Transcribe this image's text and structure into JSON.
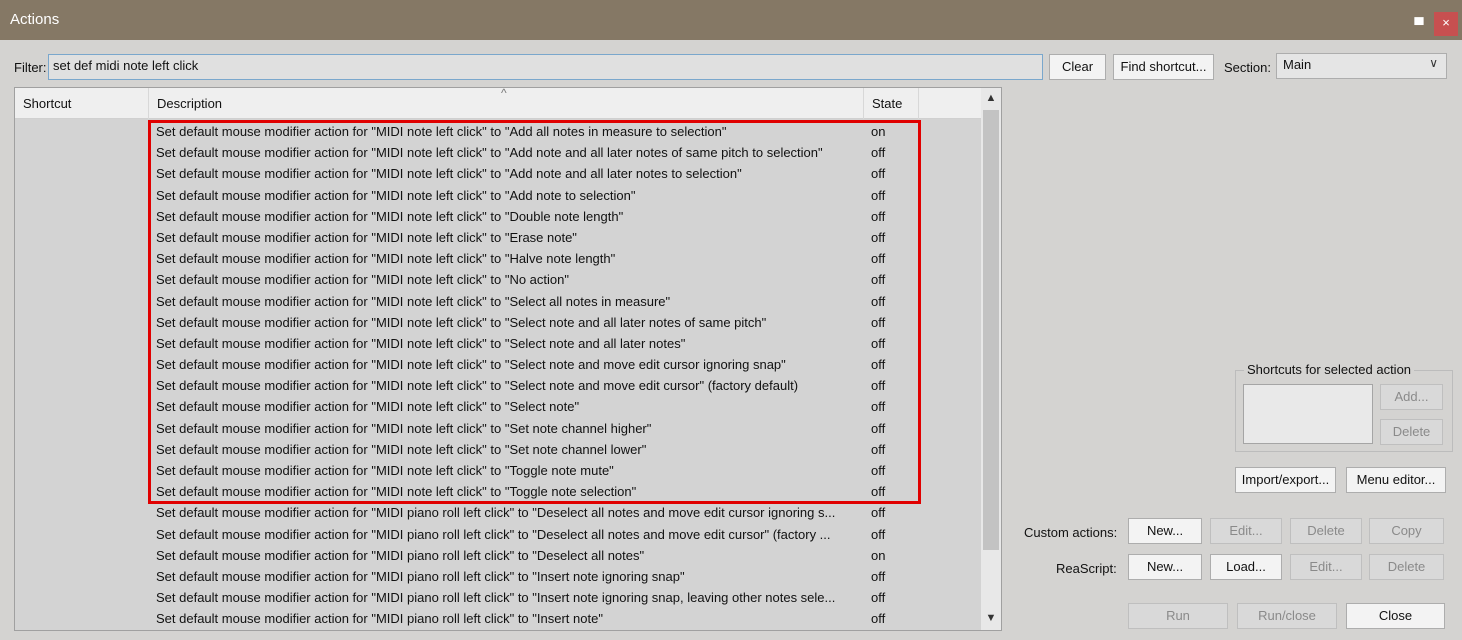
{
  "window": {
    "title": "Actions",
    "pin_glyph": "▀",
    "close_glyph": "×"
  },
  "filter": {
    "label": "Filter:",
    "value": "set def midi note left click"
  },
  "toolbar": {
    "clear_label": "Clear",
    "find_shortcut_label": "Find shortcut...",
    "section_label": "Section:",
    "section_value": "Main"
  },
  "list": {
    "columns": {
      "shortcut": "Shortcut",
      "description": "Description",
      "state": "State"
    },
    "rows": [
      {
        "shortcut": "",
        "description": "Set default mouse modifier action for \"MIDI note left click\" to \"Add all notes in measure to selection\"",
        "state": "on"
      },
      {
        "shortcut": "",
        "description": "Set default mouse modifier action for \"MIDI note left click\" to \"Add note and all later notes of same pitch to selection\"",
        "state": "off"
      },
      {
        "shortcut": "",
        "description": "Set default mouse modifier action for \"MIDI note left click\" to \"Add note and all later notes to selection\"",
        "state": "off"
      },
      {
        "shortcut": "",
        "description": "Set default mouse modifier action for \"MIDI note left click\" to \"Add note to selection\"",
        "state": "off"
      },
      {
        "shortcut": "",
        "description": "Set default mouse modifier action for \"MIDI note left click\" to \"Double note length\"",
        "state": "off"
      },
      {
        "shortcut": "",
        "description": "Set default mouse modifier action for \"MIDI note left click\" to \"Erase note\"",
        "state": "off"
      },
      {
        "shortcut": "",
        "description": "Set default mouse modifier action for \"MIDI note left click\" to \"Halve note length\"",
        "state": "off"
      },
      {
        "shortcut": "",
        "description": "Set default mouse modifier action for \"MIDI note left click\" to \"No action\"",
        "state": "off"
      },
      {
        "shortcut": "",
        "description": "Set default mouse modifier action for \"MIDI note left click\" to \"Select all notes in measure\"",
        "state": "off"
      },
      {
        "shortcut": "",
        "description": "Set default mouse modifier action for \"MIDI note left click\" to \"Select note and all later notes of same pitch\"",
        "state": "off"
      },
      {
        "shortcut": "",
        "description": "Set default mouse modifier action for \"MIDI note left click\" to \"Select note and all later notes\"",
        "state": "off"
      },
      {
        "shortcut": "",
        "description": "Set default mouse modifier action for \"MIDI note left click\" to \"Select note and move edit cursor ignoring snap\"",
        "state": "off"
      },
      {
        "shortcut": "",
        "description": "Set default mouse modifier action for \"MIDI note left click\" to \"Select note and move edit cursor\" (factory default)",
        "state": "off"
      },
      {
        "shortcut": "",
        "description": "Set default mouse modifier action for \"MIDI note left click\" to \"Select note\"",
        "state": "off"
      },
      {
        "shortcut": "",
        "description": "Set default mouse modifier action for \"MIDI note left click\" to \"Set note channel higher\"",
        "state": "off"
      },
      {
        "shortcut": "",
        "description": "Set default mouse modifier action for \"MIDI note left click\" to \"Set note channel lower\"",
        "state": "off"
      },
      {
        "shortcut": "",
        "description": "Set default mouse modifier action for \"MIDI note left click\" to \"Toggle note mute\"",
        "state": "off"
      },
      {
        "shortcut": "",
        "description": "Set default mouse modifier action for \"MIDI note left click\" to \"Toggle note selection\"",
        "state": "off"
      },
      {
        "shortcut": "",
        "description": "Set default mouse modifier action for \"MIDI piano roll left click\" to \"Deselect all notes and move edit cursor ignoring s...",
        "state": "off"
      },
      {
        "shortcut": "",
        "description": "Set default mouse modifier action for \"MIDI piano roll left click\" to \"Deselect all notes and move edit cursor\" (factory ...",
        "state": "off"
      },
      {
        "shortcut": "",
        "description": "Set default mouse modifier action for \"MIDI piano roll left click\" to \"Deselect all notes\"",
        "state": "on"
      },
      {
        "shortcut": "",
        "description": "Set default mouse modifier action for \"MIDI piano roll left click\" to \"Insert note ignoring snap\"",
        "state": "off"
      },
      {
        "shortcut": "",
        "description": "Set default mouse modifier action for \"MIDI piano roll left click\" to \"Insert note ignoring snap, leaving other notes sele...",
        "state": "off"
      },
      {
        "shortcut": "",
        "description": "Set default mouse modifier action for \"MIDI piano roll left click\" to \"Insert note\"",
        "state": "off"
      }
    ]
  },
  "shortcuts_group": {
    "title": "Shortcuts for selected action",
    "add_label": "Add...",
    "delete_label": "Delete"
  },
  "buttons": {
    "import_export": "Import/export...",
    "menu_editor": "Menu editor...",
    "custom_actions_label": "Custom actions:",
    "custom_new": "New...",
    "custom_edit": "Edit...",
    "custom_delete": "Delete",
    "custom_copy": "Copy",
    "reascript_label": "ReaScript:",
    "reascript_new": "New...",
    "reascript_load": "Load...",
    "reascript_edit": "Edit...",
    "reascript_delete": "Delete",
    "run": "Run",
    "run_close": "Run/close",
    "close": "Close"
  },
  "icons": {
    "sort_caret": "^",
    "scroll_up": "▲",
    "scroll_down": "▼",
    "dropdown": "∨"
  }
}
